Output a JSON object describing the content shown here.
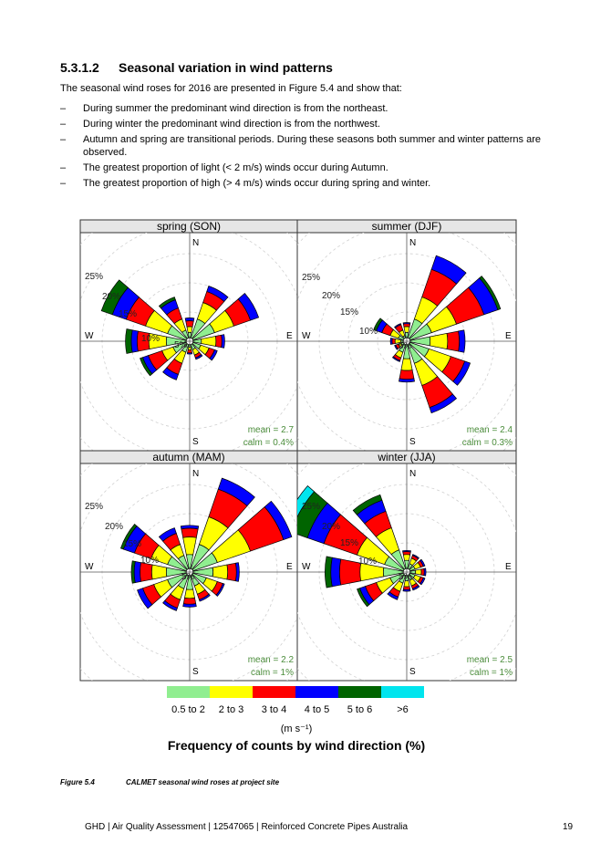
{
  "section": {
    "number": "5.3.1.2",
    "title": "Seasonal variation in wind patterns",
    "intro": "The seasonal wind roses for 2016 are presented in Figure 5.4 and show that:",
    "bullets": [
      "During summer the predominant wind direction is from the northeast.",
      "During winter the predominant wind direction is from the northwest.",
      "Autumn and spring are transitional periods. During these seasons both summer and winter patterns are observed.",
      "The greatest proportion of light (< 2 m/s) winds occur during Autumn.",
      "The greatest proportion of high (> 4 m/s) winds occur during spring and winter."
    ],
    "bullet_marker": "–"
  },
  "figure": {
    "compass": {
      "n": "N",
      "s": "S",
      "e": "E",
      "w": "W"
    },
    "ring_labels": [
      "5%",
      "10%",
      "15%",
      "20%",
      "25%"
    ],
    "panels": [
      {
        "title": "spring (SON)",
        "mean": "mean = 2.7",
        "calm": "calm = 0.4%"
      },
      {
        "title": "summer (DJF)",
        "mean": "mean = 2.4",
        "calm": "calm = 0.3%"
      },
      {
        "title": "autumn (MAM)",
        "mean": "mean = 2.2",
        "calm": "calm = 1%"
      },
      {
        "title": "winter (JJA)",
        "mean": "mean = 2.5",
        "calm": "calm = 1%"
      }
    ],
    "legend": {
      "bins": [
        "0.5 to 2",
        "2 to 3",
        "3 to 4",
        "4 to 5",
        "5 to 6",
        ">6"
      ],
      "colors": [
        "#90ee90",
        "#ffff00",
        "#ff0000",
        "#0000ff",
        "#006400",
        "#00e5ee"
      ],
      "unit": "(m s⁻¹)",
      "title": "Frequency of counts by wind direction (%)"
    },
    "caption_number": "Figure 5.4",
    "caption_text": "CALMET seasonal wind roses at project site"
  },
  "chart_data": [
    {
      "type": "wind_rose",
      "title": "spring (SON)",
      "directions_deg": [
        0,
        30,
        60,
        90,
        120,
        150,
        180,
        210,
        240,
        270,
        300,
        330
      ],
      "bins": [
        "0.5 to 2",
        "2 to 3",
        "3 to 4",
        "4 to 5",
        "5 to 6",
        ">6"
      ],
      "cumulative_percent": [
        [
          1.5,
          2.5,
          3.5,
          4.0,
          4.0,
          4.0
        ],
        [
          4,
          7,
          9,
          10,
          10,
          10
        ],
        [
          4.5,
          8,
          11,
          12.5,
          12.5,
          12.5
        ],
        [
          2,
          4.5,
          5.5,
          6,
          6,
          6
        ],
        [
          2,
          3.5,
          4.5,
          5,
          5,
          5
        ],
        [
          1.5,
          2.5,
          3,
          3.3,
          3.3,
          3.3
        ],
        [
          1,
          1.5,
          2,
          2.2,
          2.2,
          2.2
        ],
        [
          2,
          4,
          6,
          7,
          7,
          7
        ],
        [
          3,
          5,
          7.5,
          8.5,
          9,
          9
        ],
        [
          4,
          7,
          9,
          10,
          11,
          11
        ],
        [
          4,
          8,
          11.5,
          14,
          16,
          16
        ],
        [
          2,
          4,
          6,
          7.5,
          8,
          8
        ]
      ],
      "rlim": [
        0,
        25
      ],
      "mean": 2.7,
      "calm_percent": 0.4
    },
    {
      "type": "wind_rose",
      "title": "summer (DJF)",
      "directions_deg": [
        0,
        30,
        60,
        90,
        120,
        150,
        180,
        210,
        240,
        270,
        300,
        330
      ],
      "bins": [
        "0.5 to 2",
        "2 to 3",
        "3 to 4",
        "4 to 5",
        "5 to 6",
        ">6"
      ],
      "cumulative_percent": [
        [
          1.5,
          2.5,
          3,
          3.2,
          3.2,
          3.2
        ],
        [
          4,
          8,
          13,
          15.5,
          15.5,
          15.5
        ],
        [
          4.5,
          9,
          14,
          16.5,
          17,
          17
        ],
        [
          4,
          7,
          9,
          10,
          10,
          10
        ],
        [
          4,
          8,
          10.5,
          11.5,
          11.5,
          11.5
        ],
        [
          4,
          8,
          12,
          13,
          13,
          13
        ],
        [
          3,
          5,
          6.5,
          7,
          7,
          7
        ],
        [
          2,
          3,
          3.5,
          3.7,
          3.7,
          3.7
        ],
        [
          1,
          1.5,
          2,
          2.2,
          2.2,
          2.2
        ],
        [
          1,
          2,
          2.5,
          2.8,
          2.8,
          2.8
        ],
        [
          1.5,
          3,
          4.5,
          5.5,
          6,
          6
        ],
        [
          1,
          2,
          3,
          3.2,
          3.2,
          3.2
        ]
      ],
      "rlim": [
        0,
        25
      ],
      "mean": 2.4,
      "calm_percent": 0.3
    },
    {
      "type": "wind_rose",
      "title": "autumn (MAM)",
      "directions_deg": [
        0,
        30,
        60,
        90,
        120,
        150,
        180,
        210,
        240,
        270,
        300,
        330
      ],
      "bins": [
        "0.5 to 2",
        "2 to 3",
        "3 to 4",
        "4 to 5",
        "5 to 6",
        ">6"
      ],
      "cumulative_percent": [
        [
          3,
          6,
          7.5,
          8,
          8,
          8
        ],
        [
          5,
          10,
          15,
          17,
          17,
          17
        ],
        [
          5,
          11,
          17,
          18.5,
          18.5,
          18.5
        ],
        [
          4,
          6.5,
          8,
          8.5,
          8.5,
          8.5
        ],
        [
          3,
          5,
          6,
          6.3,
          6.3,
          6.3
        ],
        [
          2.5,
          4,
          5,
          5.3,
          5.3,
          5.3
        ],
        [
          3,
          4.5,
          5.5,
          6,
          6,
          6
        ],
        [
          3,
          5,
          6.5,
          7,
          7,
          7
        ],
        [
          4,
          6.5,
          8.5,
          9.5,
          9.5,
          9.5
        ],
        [
          4,
          6.5,
          8.5,
          9.5,
          10,
          10
        ],
        [
          4,
          7,
          10,
          12,
          12.5,
          12.5
        ],
        [
          3,
          5,
          7,
          8,
          8,
          8
        ]
      ],
      "rlim": [
        0,
        25
      ],
      "mean": 2.2,
      "calm_percent": 1
    },
    {
      "type": "wind_rose",
      "title": "winter (JJA)",
      "directions_deg": [
        0,
        30,
        60,
        90,
        120,
        150,
        180,
        210,
        240,
        270,
        300,
        330
      ],
      "bins": [
        "0.5 to 2",
        "2 to 3",
        "3 to 4",
        "4 to 5",
        "5 to 6",
        ">6"
      ],
      "cumulative_percent": [
        [
          2,
          3,
          3.5,
          3.7,
          3.7,
          3.7
        ],
        [
          1.5,
          2.5,
          3,
          3.2,
          3.2,
          3.2
        ],
        [
          1.5,
          2.5,
          3,
          3.3,
          3.3,
          3.3
        ],
        [
          1.5,
          2.5,
          3,
          3.3,
          3.3,
          3.3
        ],
        [
          1.5,
          2.5,
          3,
          3.3,
          3.3,
          3.3
        ],
        [
          1.5,
          2.5,
          3,
          3.3,
          3.3,
          3.3
        ],
        [
          1.5,
          2.5,
          3,
          3.3,
          3.3,
          3.3
        ],
        [
          2,
          3.5,
          4.5,
          5,
          5,
          5
        ],
        [
          3,
          5.5,
          7.5,
          8.5,
          9,
          9
        ],
        [
          4,
          8,
          11.5,
          13,
          14,
          14
        ],
        [
          4,
          9,
          15,
          18,
          21,
          22.5
        ],
        [
          4,
          8,
          11,
          13,
          14,
          14
        ]
      ],
      "rlim": [
        0,
        25
      ],
      "mean": 2.5,
      "calm_percent": 1
    }
  ],
  "footer": {
    "text": "GHD | Air Quality Assessment | 12547065 | Reinforced Concrete Pipes Australia",
    "page": "19"
  }
}
